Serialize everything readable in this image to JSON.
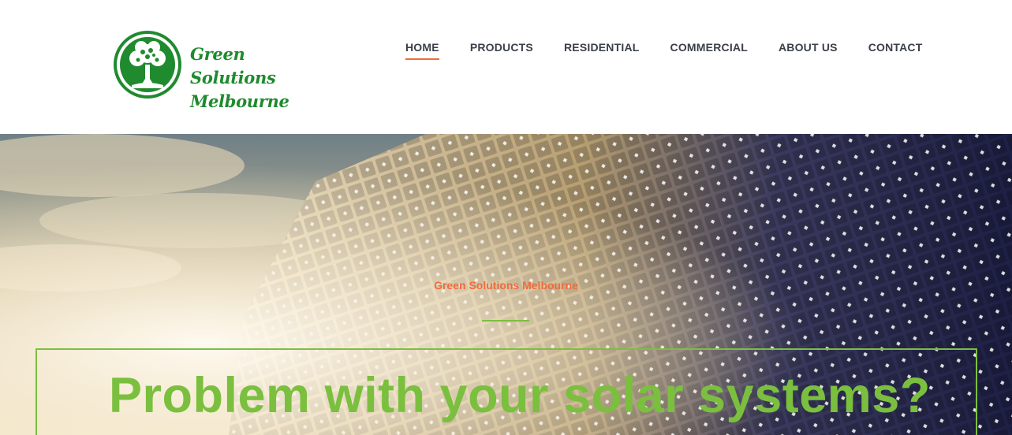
{
  "brand": {
    "name_line1": "Green Solutions",
    "name_line2": "Melbourne",
    "color": "#1f8a2e",
    "icon": "tree-logo-icon"
  },
  "nav": {
    "items": [
      {
        "label": "HOME",
        "active": true
      },
      {
        "label": "PRODUCTS",
        "active": false
      },
      {
        "label": "RESIDENTIAL",
        "active": false
      },
      {
        "label": "COMMERCIAL",
        "active": false
      },
      {
        "label": "ABOUT US",
        "active": false
      },
      {
        "label": "CONTACT",
        "active": false
      }
    ],
    "active_underline_color": "#ef6c3b"
  },
  "hero": {
    "eyebrow": "Green Solutions Melbourne",
    "headline": "Problem with your solar systems?",
    "accent_color": "#7bbf3f",
    "eyebrow_color": "#ef6c3b",
    "background": "solar-panels-photo"
  }
}
